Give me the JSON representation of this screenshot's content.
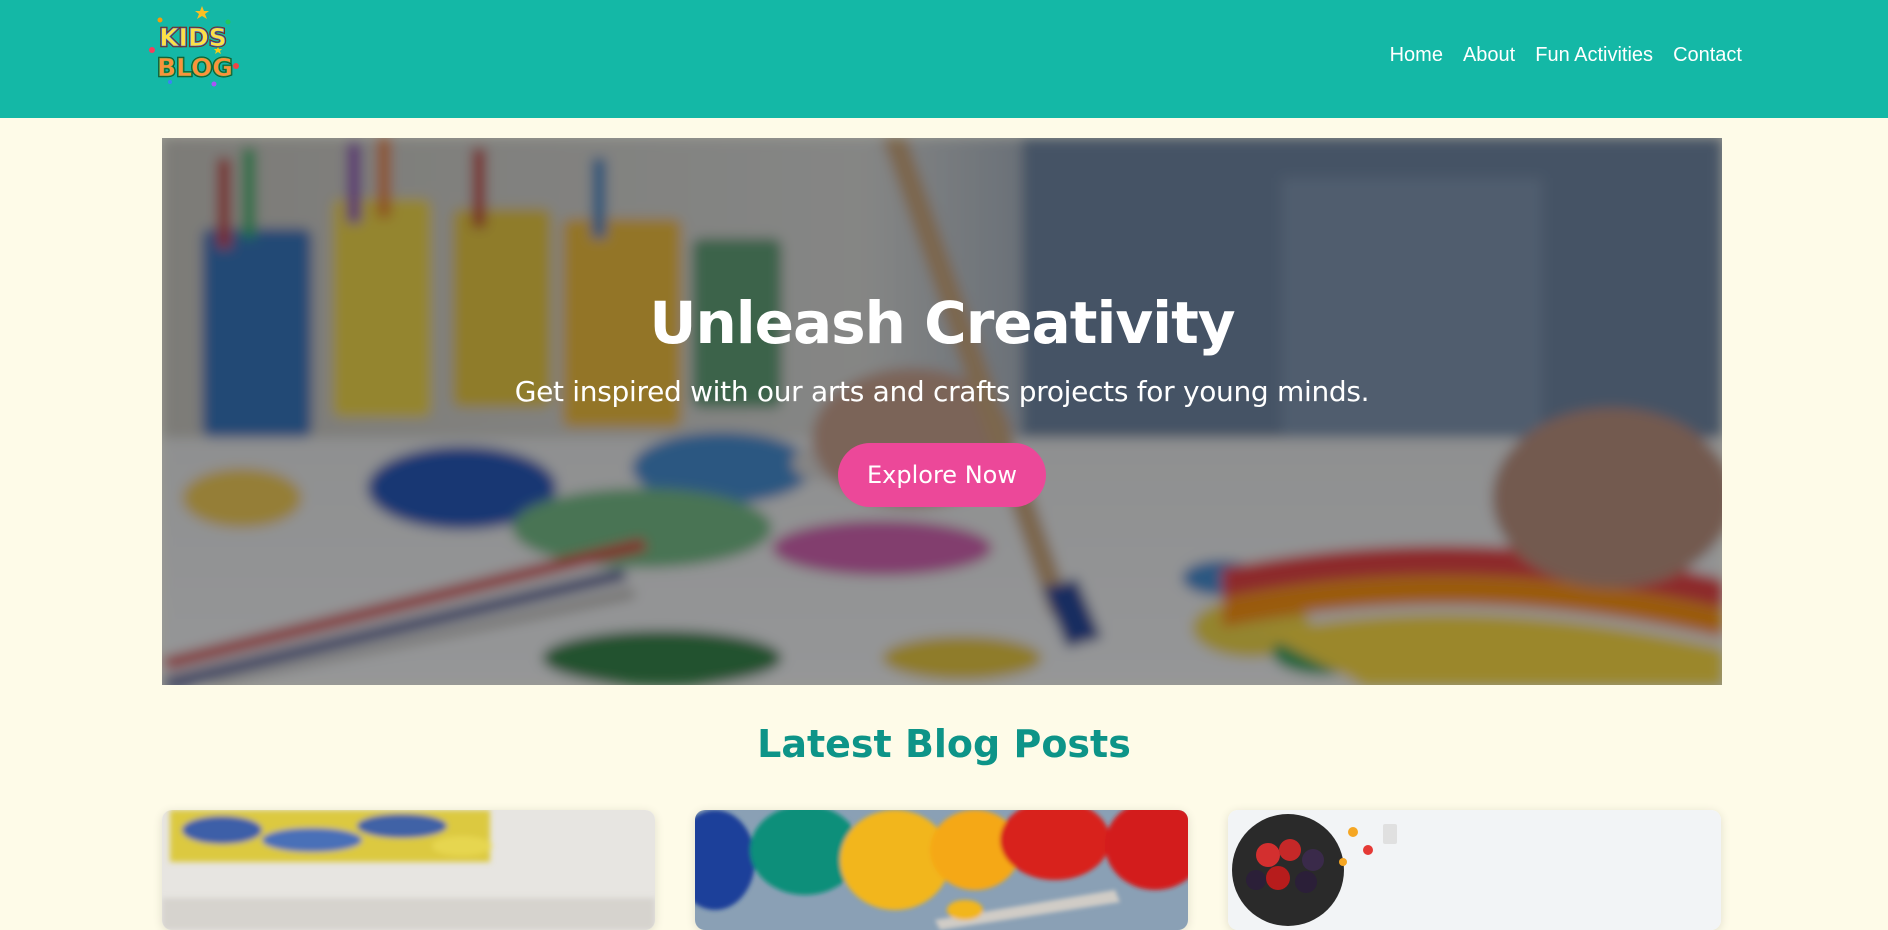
{
  "header": {
    "logo_text": "KIDS BLOG",
    "nav": [
      {
        "label": "Home"
      },
      {
        "label": "About"
      },
      {
        "label": "Fun Activities"
      },
      {
        "label": "Contact"
      }
    ]
  },
  "hero": {
    "title": "Unleash Creativity",
    "subtitle": "Get inspired with our arts and crafts projects for young minds.",
    "button_label": "Explore Now"
  },
  "latest": {
    "title": "Latest Blog Posts"
  },
  "colors": {
    "header_bg": "#14b8a6",
    "page_bg": "#fefbe8",
    "accent_pink": "#ec4899",
    "section_title": "#0d9488"
  }
}
